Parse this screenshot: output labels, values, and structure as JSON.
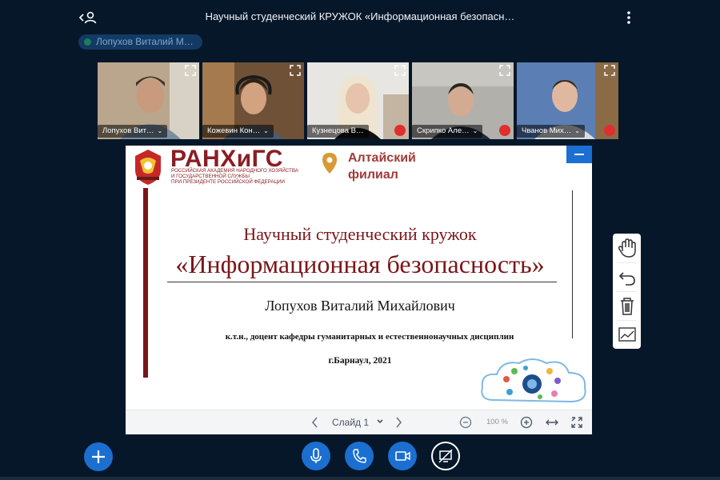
{
  "header": {
    "title": "Научный студенческий КРУЖОК «Информационная безопасн…",
    "users_icon": "users-toggle-icon",
    "options_icon": "more-vertical-icon"
  },
  "presenter": {
    "name": "Лопухов Виталий М…"
  },
  "videos": [
    {
      "name": "Лопухов Вит…",
      "muted": false
    },
    {
      "name": "Кожевин Кон…",
      "muted": false
    },
    {
      "name": "Кузнецова В…",
      "muted": true
    },
    {
      "name": "Скрипко Але…",
      "muted": true
    },
    {
      "name": "Чванов Мих…",
      "muted": true
    }
  ],
  "slide": {
    "org_short": "РАНХиГС",
    "org_full_1": "РОССИЙСКАЯ АКАДЕМИЯ НАРОДНОГО ХОЗЯЙСТВА",
    "org_full_2": "И ГОСУДАРСТВЕННОЙ СЛУЖБЫ",
    "org_full_3": "ПРИ ПРЕЗИДЕНТЕ РОССИЙСКОЙ ФЕДЕРАЦИИ",
    "branch_1": "Алтайский",
    "branch_2": "филиал",
    "title_line1": "Научный студенческий кружок",
    "title_line2": "«Информационная безопасность»",
    "author": "Лопухов Виталий Михайлович",
    "degree": "к.т.н., доцент кафедры гуманитарных и естественнонаучных дисциплин",
    "city_year": "г.Барнаул, 2021"
  },
  "slide_toolbar": {
    "prev_icon": "chevron-left-icon",
    "slide_label": "Слайд 1",
    "next_icon": "chevron-right-icon",
    "zoom_out_icon": "zoom-out-icon",
    "zoom": "100 %",
    "zoom_in_icon": "zoom-in-icon",
    "fit_width_icon": "fit-width-icon",
    "fullscreen_icon": "fullscreen-icon"
  },
  "annotation_tools": [
    "hand-icon",
    "undo-icon",
    "trash-icon",
    "chart-icon"
  ],
  "controls": {
    "actions": "plus-icon",
    "mic": "microphone-icon",
    "phone": "phone-icon",
    "camera": "camera-icon",
    "screen": "screen-share-off-icon"
  },
  "colors": {
    "background": "#06172a",
    "accent": "#1b6fd1",
    "mute_red": "#e02d2d",
    "slide_maroon": "#7a1619"
  }
}
